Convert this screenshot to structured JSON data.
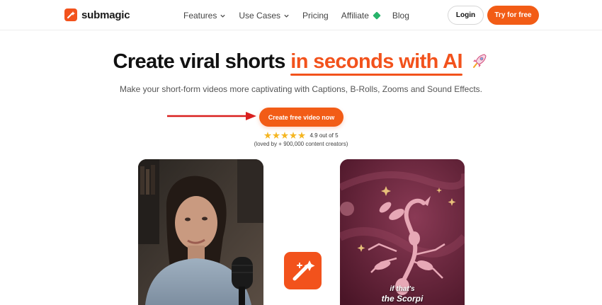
{
  "brand": {
    "name": "submagic",
    "accent": "#f2521c"
  },
  "nav": {
    "items": [
      {
        "label": "Features",
        "dropdown": true
      },
      {
        "label": "Use Cases",
        "dropdown": true
      },
      {
        "label": "Pricing",
        "dropdown": false
      },
      {
        "label": "Affiliate",
        "dropdown": false,
        "icon": "green-diamond-icon"
      },
      {
        "label": "Blog",
        "dropdown": false
      }
    ],
    "login_label": "Login",
    "try_label": "Try for free"
  },
  "hero": {
    "headline_prefix": "Create viral shorts ",
    "headline_accent": "in seconds with AI",
    "headline_icon": "rocket-icon",
    "subhead": "Make your short-form videos more captivating with Captions, B-Rolls, Zooms and Sound Effects.",
    "cta_label": "Create free video now",
    "rating_text": "4.9 out of 5",
    "rating_value": 5,
    "loved_text": "(loved by + 900,000 content creators)"
  },
  "showcase": {
    "left_card": "woman-podcast-image",
    "center_icon": "submagic-wand-icon",
    "right_card": "scorpion-zodiac-image",
    "right_caption_line1": "if that's",
    "right_caption_line2": "the Scorpi"
  },
  "colors": {
    "primary": "#f25c16",
    "star": "#f5b622",
    "affiliate_diamond": "#27b36a"
  }
}
